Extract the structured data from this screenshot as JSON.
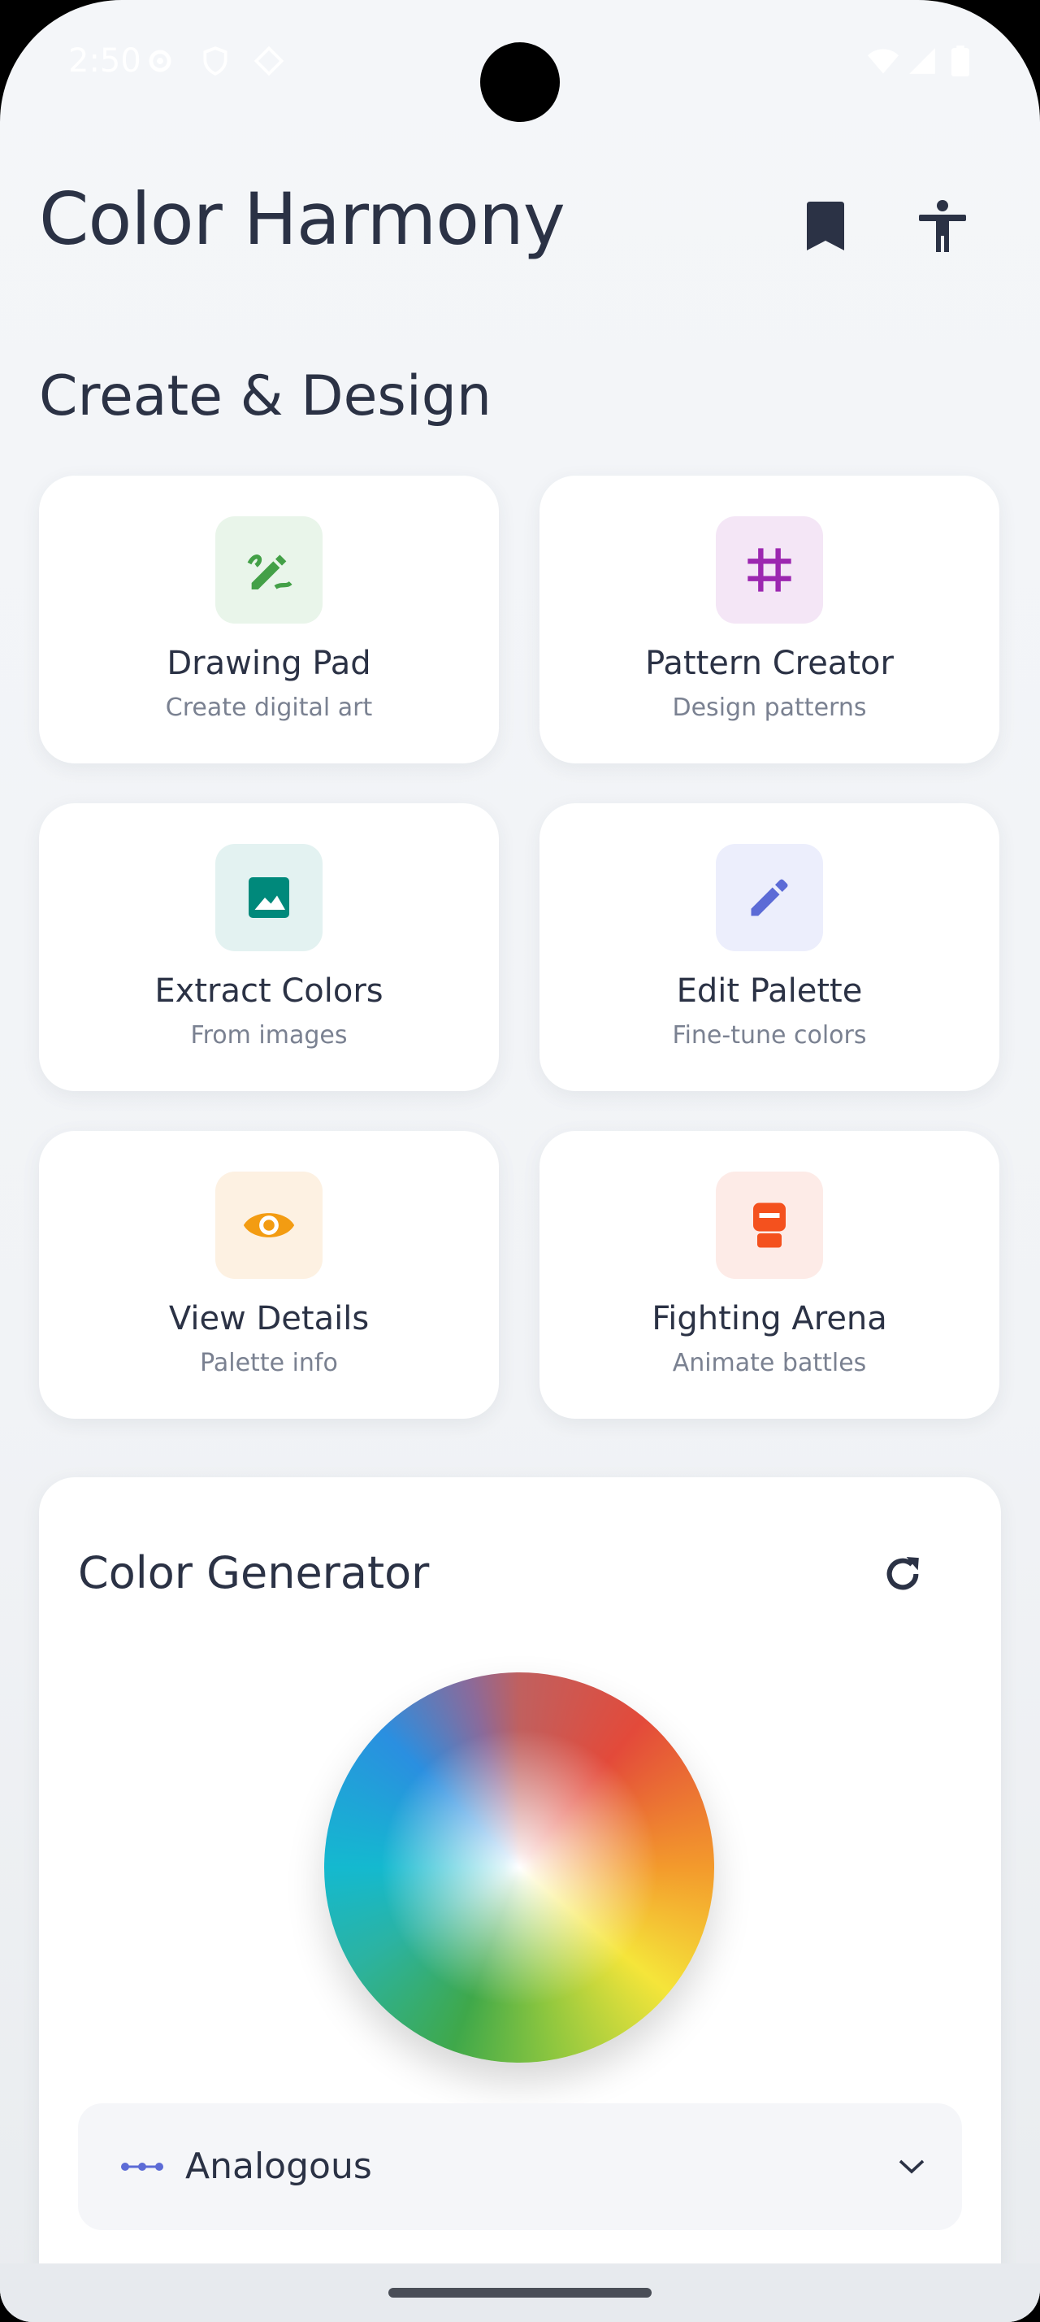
{
  "status_bar": {
    "time": "2:50",
    "left_icons": [
      "gear-icon",
      "shield-icon",
      "at-sign-icon"
    ],
    "right_icons": [
      "wifi-icon",
      "signal-icon",
      "battery-icon"
    ]
  },
  "app": {
    "title": "Color Harmony",
    "actions": [
      "bookmark-icon",
      "accessibility-icon"
    ]
  },
  "section": {
    "title": "Create & Design"
  },
  "tools": [
    {
      "title": "Drawing Pad",
      "subtitle": "Create digital art",
      "icon": "draw-icon",
      "bg": "#e9f5ea",
      "color": "#43a047"
    },
    {
      "title": "Pattern Creator",
      "subtitle": "Design patterns",
      "icon": "grid-icon",
      "bg": "#f4e6f6",
      "color": "#9c27b0"
    },
    {
      "title": "Extract Colors",
      "subtitle": "From images",
      "icon": "image-icon",
      "bg": "#e3f2f1",
      "color": "#00897b"
    },
    {
      "title": "Edit Palette",
      "subtitle": "Fine-tune colors",
      "icon": "pencil-icon",
      "bg": "#eceefc",
      "color": "#5c6bd6"
    },
    {
      "title": "View Details",
      "subtitle": "Palette info",
      "icon": "eye-icon",
      "bg": "#fdf1e2",
      "color": "#f39c12"
    },
    {
      "title": "Fighting Arena",
      "subtitle": "Animate battles",
      "icon": "boxing-glove-icon",
      "bg": "#fdebe7",
      "color": "#f4511e"
    }
  ],
  "generator": {
    "title": "Color Generator",
    "harmony": "Analogous",
    "accent": "#5c6bd6"
  }
}
